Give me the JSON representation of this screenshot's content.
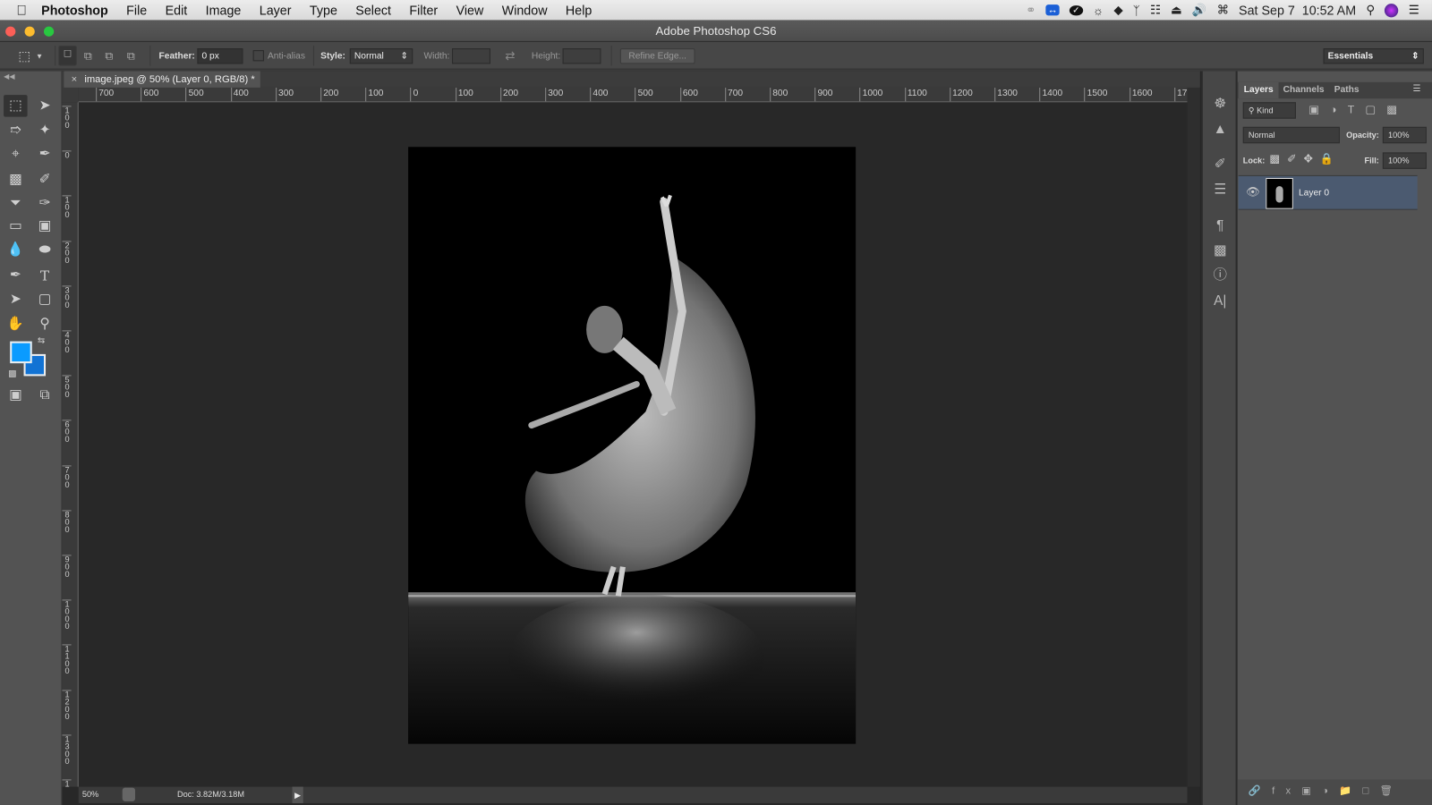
{
  "menubar": {
    "app_name": "Photoshop",
    "items": [
      "File",
      "Edit",
      "Image",
      "Layer",
      "Type",
      "Select",
      "Filter",
      "View",
      "Window",
      "Help"
    ],
    "clock": "Sat Sep 7  10:52 AM",
    "status_icons": [
      "creative-cloud-icon",
      "teamviewer-icon",
      "checkmark-app-icon",
      "brightness-icon",
      "dropbox-icon",
      "bluetooth-icon",
      "wifi-icon",
      "eject-icon",
      "volume-icon",
      "keyboard-viewer-icon",
      "spotlight-icon",
      "siri-icon",
      "notification-center-icon"
    ]
  },
  "window": {
    "title": "Adobe Photoshop CS6"
  },
  "options_bar": {
    "feather_label": "Feather:",
    "feather_value": "0 px",
    "antialias_label": "Anti-alias",
    "style_label": "Style:",
    "style_value": "Normal",
    "width_label": "Width:",
    "height_label": "Height:",
    "refine_edge": "Refine Edge...",
    "workspace": "Essentials"
  },
  "document": {
    "tab_title": "image.jpeg @ 50% (Layer 0, RGB/8) *",
    "h_ruler": [
      "700",
      "600",
      "500",
      "400",
      "300",
      "200",
      "100",
      "0",
      "100",
      "200",
      "300",
      "400",
      "500",
      "600",
      "700",
      "800",
      "900",
      "1000",
      "1100",
      "1200",
      "1300",
      "1400",
      "1500",
      "1600",
      "170"
    ],
    "v_ruler": [
      "100",
      "0",
      "100",
      "200",
      "300",
      "400",
      "500",
      "600",
      "700",
      "800",
      "900",
      "1000",
      "1100",
      "1200",
      "1300",
      "14"
    ],
    "zoom": "50%",
    "doc_size": "Doc: 3.82M/3.18M"
  },
  "colors": {
    "foreground": "#0a9bff",
    "background": "#1273d4",
    "layer_selected": "#4b5a70"
  },
  "layers_panel": {
    "tabs": [
      "Layers",
      "Channels",
      "Paths"
    ],
    "active_tab": "Layers",
    "filter_kind": "Kind",
    "blend_mode": "Normal",
    "opacity_label": "Opacity:",
    "opacity_value": "100%",
    "lock_label": "Lock:",
    "fill_label": "Fill:",
    "fill_value": "100%",
    "layers": [
      {
        "name": "Layer 0",
        "visible": true
      }
    ]
  }
}
